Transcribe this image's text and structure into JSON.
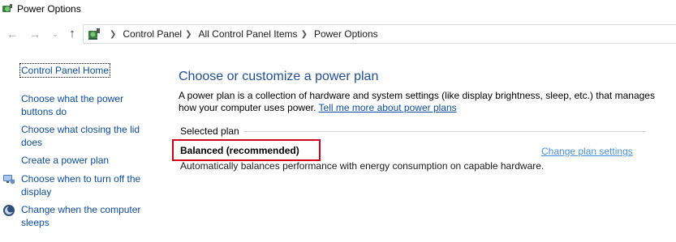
{
  "window": {
    "title": "Power Options"
  },
  "navigation": {
    "back_icon": "back-arrow-icon",
    "forward_icon": "forward-arrow-icon",
    "recent_icon": "chevron-down-icon",
    "up_icon": "up-arrow-icon",
    "breadcrumb": [
      "Control Panel",
      "All Control Panel Items",
      "Power Options"
    ]
  },
  "sidebar": {
    "home": "Control Panel Home",
    "items": [
      {
        "label_line1": "Choose what the power",
        "label_line2": "buttons do",
        "icon": null
      },
      {
        "label_line1": "Choose what closing the lid",
        "label_line2": "does",
        "icon": null
      },
      {
        "label_line1": "Create a power plan",
        "label_line2": "",
        "icon": null
      },
      {
        "label_line1": "Choose when to turn off the",
        "label_line2": "display",
        "icon": "monitor-shield-icon"
      },
      {
        "label_line1": "Change when the computer",
        "label_line2": "sleeps",
        "icon": "moon-sleep-icon"
      }
    ]
  },
  "main": {
    "heading": "Choose or customize a power plan",
    "intro_text": "A power plan is a collection of hardware and system settings (like display brightness, sleep, etc.) that manages how your computer uses power.",
    "intro_link": "Tell me more about power plans",
    "group_label": "Selected plan",
    "plan": {
      "name": "Balanced (recommended)",
      "change_link": "Change plan settings",
      "description": "Automatically balances performance with energy consumption on capable hardware."
    }
  },
  "colors": {
    "link": "#0c4da2",
    "heading": "#1f4e99",
    "highlight": "#d0021b"
  }
}
